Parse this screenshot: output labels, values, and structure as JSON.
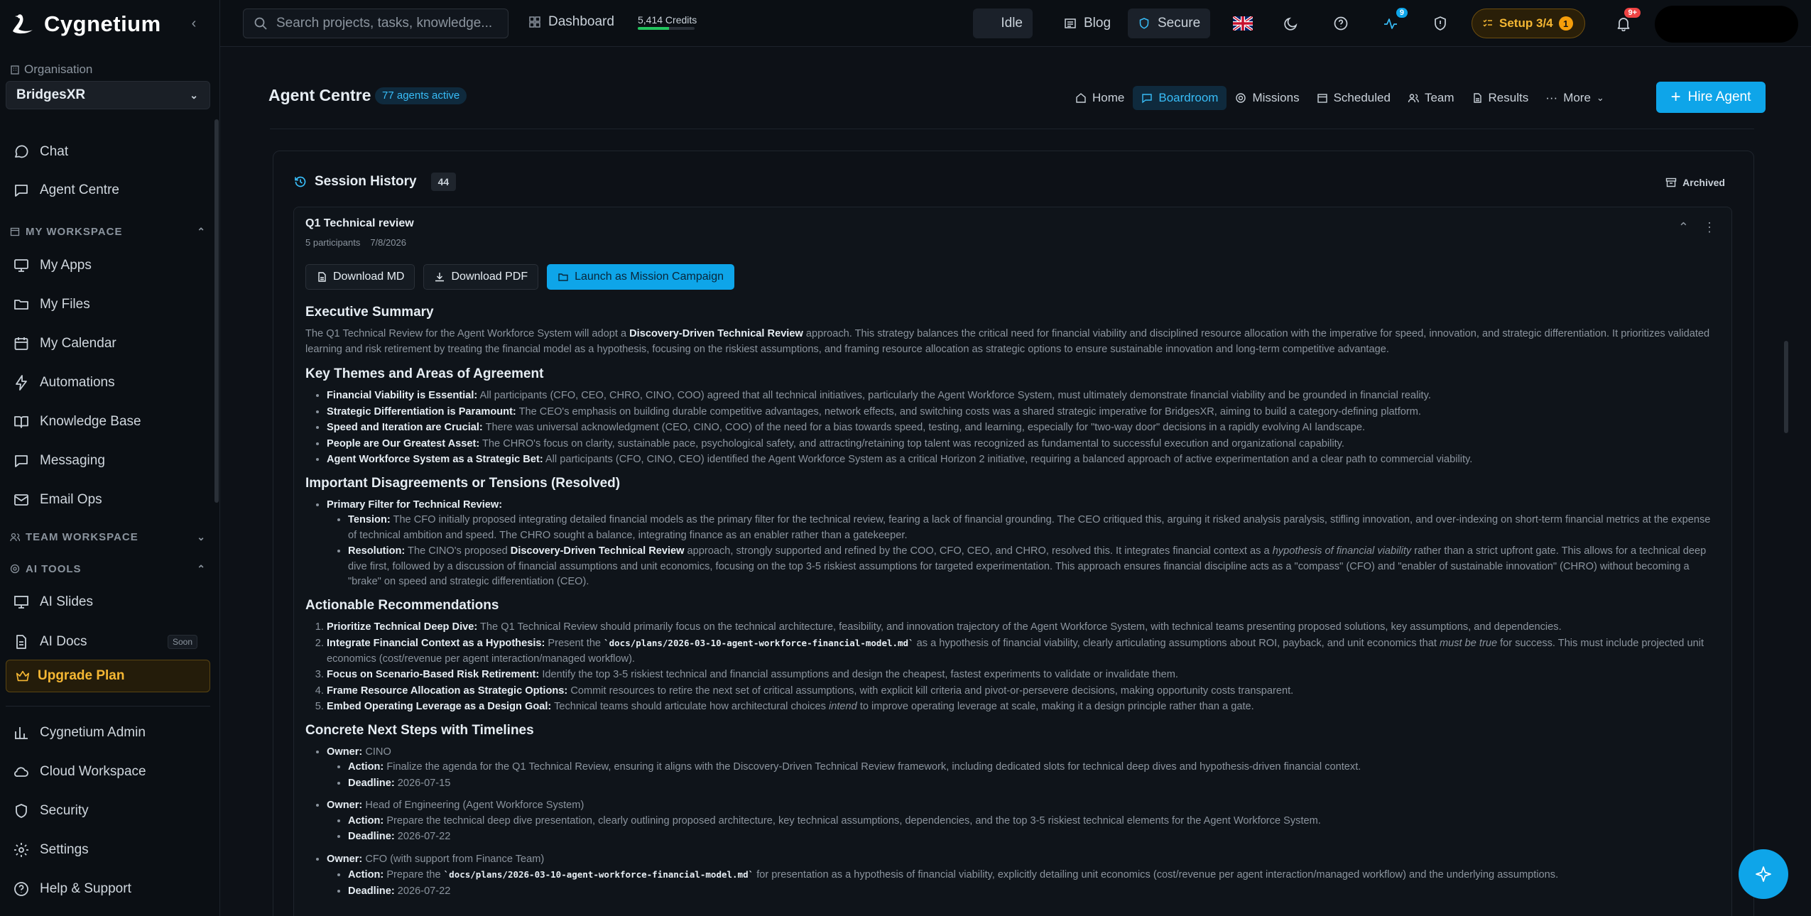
{
  "brand": {
    "name": "Cygnetium"
  },
  "organisation": {
    "label": "Organisation",
    "selected": "BridgesXR"
  },
  "sidebar": {
    "items": [
      {
        "label": "Chat"
      },
      {
        "label": "Agent Centre"
      },
      {
        "label": "My Apps"
      },
      {
        "label": "My Files"
      },
      {
        "label": "My Calendar"
      },
      {
        "label": "Automations"
      },
      {
        "label": "Knowledge Base"
      },
      {
        "label": "Messaging"
      },
      {
        "label": "Email Ops"
      },
      {
        "label": "AI Slides"
      },
      {
        "label": "AI Docs",
        "badge": "Soon"
      }
    ],
    "sections": {
      "my_workspace": "MY WORKSPACE",
      "team_workspace": "TEAM WORKSPACE",
      "ai_tools": "AI TOOLS"
    },
    "upgrade": "Upgrade Plan",
    "bottom": [
      {
        "label": "Cygnetium Admin"
      },
      {
        "label": "Cloud Workspace"
      },
      {
        "label": "Security"
      },
      {
        "label": "Settings"
      },
      {
        "label": "Help & Support"
      }
    ]
  },
  "topbar": {
    "search_placeholder": "Search projects, tasks, knowledge...",
    "dashboard": "Dashboard",
    "credits": "5,414 Credits",
    "credits_fill": 0.55,
    "status": "Idle",
    "blog": "Blog",
    "secure": "Secure",
    "activity_badge": "9",
    "setup": "Setup 3/4",
    "setup_count": "1",
    "notif_badge": "9+"
  },
  "subheader": {
    "title": "Agent Centre",
    "agents_active": "77 agents active",
    "tabs": [
      "Home",
      "Boardroom",
      "Missions",
      "Scheduled",
      "Team",
      "Results",
      "More"
    ],
    "hire": "Hire Agent"
  },
  "session": {
    "heading": "Session History",
    "count": "44",
    "archived": "Archived",
    "card": {
      "title": "Q1 Technical review",
      "participants": "5 participants",
      "date": "7/8/2026",
      "buttons": {
        "md": "Download MD",
        "pdf": "Download PDF",
        "launch": "Launch as Mission Campaign"
      }
    }
  },
  "doc": {
    "h_exec": "Executive Summary",
    "exec_1": "The Q1 Technical Review for the Agent Workforce System will adopt a ",
    "exec_b": "Discovery-Driven Technical Review",
    "exec_2": " approach. This strategy balances the critical need for financial viability and disciplined resource allocation with the imperative for speed, innovation, and strategic differentiation. It prioritizes validated learning and risk retirement by treating the financial model as a hypothesis, focusing on the riskiest assumptions, and framing resource allocation as strategic options to ensure sustainable innovation and long-term competitive advantage.",
    "h_themes": "Key Themes and Areas of Agreement",
    "themes": [
      {
        "b": "Financial Viability is Essential:",
        "t": " All participants (CFO, CEO, CHRO, CINO, COO) agreed that all technical initiatives, particularly the Agent Workforce System, must ultimately demonstrate financial viability and be grounded in financial reality."
      },
      {
        "b": "Strategic Differentiation is Paramount:",
        "t": " The CEO's emphasis on building durable competitive advantages, network effects, and switching costs was a shared strategic imperative for BridgesXR, aiming to build a category-defining platform."
      },
      {
        "b": "Speed and Iteration are Crucial:",
        "t": " There was universal acknowledgment (CEO, CINO, COO) of the need for a bias towards speed, testing, and learning, especially for \"two-way door\" decisions in a rapidly evolving AI landscape."
      },
      {
        "b": "People are Our Greatest Asset:",
        "t": " The CHRO's focus on clarity, sustainable pace, psychological safety, and attracting/retaining top talent was recognized as fundamental to successful execution and organizational capability."
      },
      {
        "b": "Agent Workforce System as a Strategic Bet:",
        "t": " All participants (CFO, CINO, CEO) identified the Agent Workforce System as a critical Horizon 2 initiative, requiring a balanced approach of active experimentation and a clear path to commercial viability."
      }
    ],
    "h_disagree": "Important Disagreements or Tensions (Resolved)",
    "dis_primary": "Primary Filter for Technical Review:",
    "dis_tension_b": "Tension:",
    "dis_tension": " The CFO initially proposed integrating detailed financial models as the primary filter for the technical review, fearing a lack of financial grounding. The CEO critiqued this, arguing it risked analysis paralysis, stifling innovation, and over-indexing on short-term financial metrics at the expense of technical ambition and speed. The CHRO sought a balance, integrating finance as an enabler rather than a gatekeeper.",
    "dis_res_b": "Resolution:",
    "dis_res_1": " The CINO's proposed ",
    "dis_res_b2": "Discovery-Driven Technical Review",
    "dis_res_2": " approach, strongly supported and refined by the COO, CFO, CEO, and CHRO, resolved this. It integrates financial context as a ",
    "dis_res_i": "hypothesis of financial viability",
    "dis_res_3": " rather than a strict upfront gate. This allows for a technical deep dive first, followed by a discussion of financial assumptions and unit economics, focusing on the top 3-5 riskiest assumptions for targeted experimentation. This approach ensures financial discipline acts as a \"compass\" (CFO) and \"enabler of sustainable innovation\" (CHRO) without becoming a \"brake\" on speed and strategic differentiation (CEO).",
    "h_recs": "Actionable Recommendations",
    "rec1_b": "Prioritize Technical Deep Dive:",
    "rec1": " The Q1 Technical Review should primarily focus on the technical architecture, feasibility, and innovation trajectory of the Agent Workforce System, with technical teams presenting proposed solutions, key assumptions, and dependencies.",
    "rec2_b": "Integrate Financial Context as a Hypothesis:",
    "rec2_1": " Present the ",
    "rec2_code": "`docs/plans/2026-03-10-agent-workforce-financial-model.md`",
    "rec2_2": " as a hypothesis of financial viability, clearly articulating assumptions about ROI, payback, and unit economics that ",
    "rec2_i": "must be true",
    "rec2_3": " for success. This must include projected unit economics (cost/revenue per agent interaction/managed workflow).",
    "rec3_b": "Focus on Scenario-Based Risk Retirement:",
    "rec3": " Identify the top 3-5 riskiest technical and financial assumptions and design the cheapest, fastest experiments to validate or invalidate them.",
    "rec4_b": "Frame Resource Allocation as Strategic Options:",
    "rec4": " Commit resources to retire the next set of critical assumptions, with explicit kill criteria and pivot-or-persevere decisions, making opportunity costs transparent.",
    "rec5_b": "Embed Operating Leverage as a Design Goal:",
    "rec5_1": " Technical teams should articulate how architectural choices ",
    "rec5_i": "intend",
    "rec5_2": " to improve operating leverage at scale, making it a design principle rather than a gate.",
    "h_next": "Concrete Next Steps with Timelines",
    "owner_lbl": "Owner:",
    "action_lbl": "Action:",
    "deadline_lbl": "Deadline:",
    "n1_owner": " CINO",
    "n1_action": " Finalize the agenda for the Q1 Technical Review, ensuring it aligns with the Discovery-Driven Technical Review framework, including dedicated slots for technical deep dives and hypothesis-driven financial context.",
    "n1_deadline": " 2026-07-15",
    "n2_owner": " Head of Engineering (Agent Workforce System)",
    "n2_action": " Prepare the technical deep dive presentation, clearly outlining proposed architecture, key technical assumptions, dependencies, and the top 3-5 riskiest technical elements for the Agent Workforce System.",
    "n2_deadline": " 2026-07-22",
    "n3_owner": " CFO (with support from Finance Team)",
    "n3_action_1": " Prepare the ",
    "n3_code": "`docs/plans/2026-03-10-agent-workforce-financial-model.md`",
    "n3_action_2": " for presentation as a hypothesis of financial viability, explicitly detailing unit economics (cost/revenue per agent interaction/managed workflow) and the underlying assumptions.",
    "n3_deadline": " 2026-07-22"
  }
}
